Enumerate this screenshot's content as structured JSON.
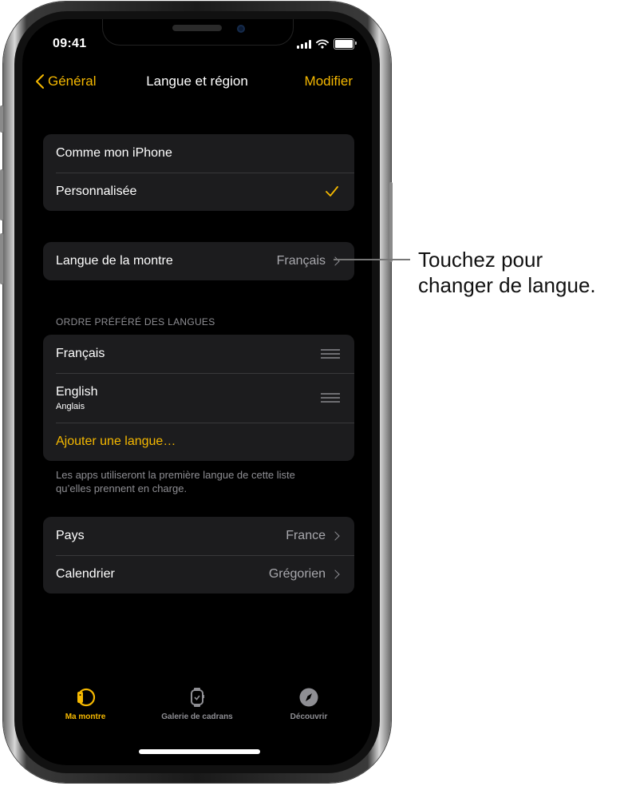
{
  "status_bar": {
    "time": "09:41"
  },
  "nav": {
    "back_label": "Général",
    "title": "Langue et région",
    "edit_label": "Modifier"
  },
  "mode_group": {
    "items": [
      {
        "label": "Comme mon iPhone",
        "selected": false
      },
      {
        "label": "Personnalisée",
        "selected": true
      }
    ]
  },
  "watch_language": {
    "label": "Langue de la montre",
    "value": "Français"
  },
  "preferred_languages": {
    "header": "ORDRE PRÉFÉRÉ DES LANGUES",
    "items": [
      {
        "label": "Français",
        "sublabel": ""
      },
      {
        "label": "English",
        "sublabel": "Anglais"
      }
    ],
    "add_label": "Ajouter une langue…",
    "footer": "Les apps utiliseront la première langue de cette liste qu’elles prennent en charge."
  },
  "region_group": {
    "items": [
      {
        "label": "Pays",
        "value": "France"
      },
      {
        "label": "Calendrier",
        "value": "Grégorien"
      }
    ]
  },
  "tab_bar": {
    "tabs": [
      {
        "label": "Ma montre",
        "icon": "watch-band-icon",
        "active": true
      },
      {
        "label": "Galerie de cadrans",
        "icon": "watch-face-icon",
        "active": false
      },
      {
        "label": "Découvrir",
        "icon": "compass-icon",
        "active": false
      }
    ]
  },
  "callout": {
    "line1": "Touchez pour",
    "line2": "changer de langue."
  },
  "colors": {
    "accent": "#f5b800",
    "background": "#000000",
    "cell": "#1c1c1e",
    "secondary_text": "#8e8e93"
  }
}
